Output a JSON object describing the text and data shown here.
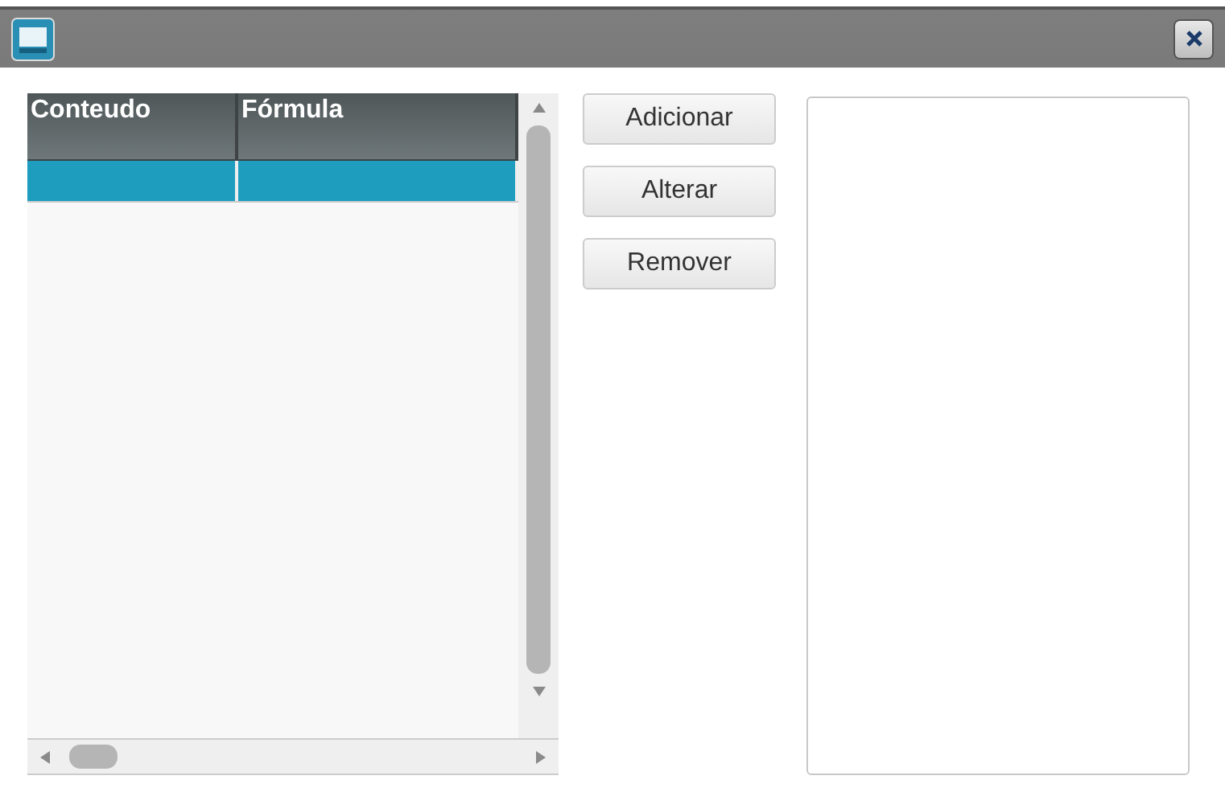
{
  "table": {
    "columns": [
      "Conteudo",
      "Fórmula"
    ],
    "rows": [
      {
        "selected": true
      }
    ]
  },
  "buttons": [
    "Adicionar",
    "Alterar",
    "Remover"
  ]
}
